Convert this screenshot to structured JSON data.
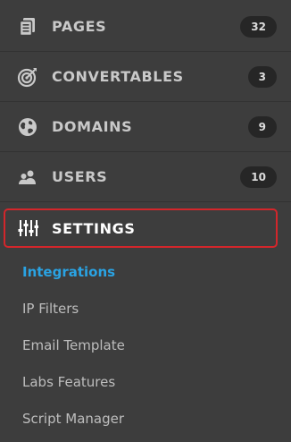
{
  "nav": [
    {
      "id": "pages",
      "label": "PAGES",
      "badge": "32",
      "icon": "pages-icon"
    },
    {
      "id": "convertables",
      "label": "CONVERTABLES",
      "badge": "3",
      "icon": "target-icon"
    },
    {
      "id": "domains",
      "label": "DOMAINS",
      "badge": "9",
      "icon": "globe-icon"
    },
    {
      "id": "users",
      "label": "USERS",
      "badge": "10",
      "icon": "users-icon"
    },
    {
      "id": "settings",
      "label": "SETTINGS",
      "icon": "sliders-icon",
      "active": true
    }
  ],
  "settings_submenu": [
    {
      "label": "Integrations",
      "active": true
    },
    {
      "label": "IP Filters"
    },
    {
      "label": "Email Template"
    },
    {
      "label": "Labs Features"
    },
    {
      "label": "Script Manager"
    }
  ],
  "colors": {
    "background": "#3d3d3d",
    "active_link": "#2aa3e3",
    "highlight_border": "#d3262b",
    "badge_bg": "#262626"
  }
}
